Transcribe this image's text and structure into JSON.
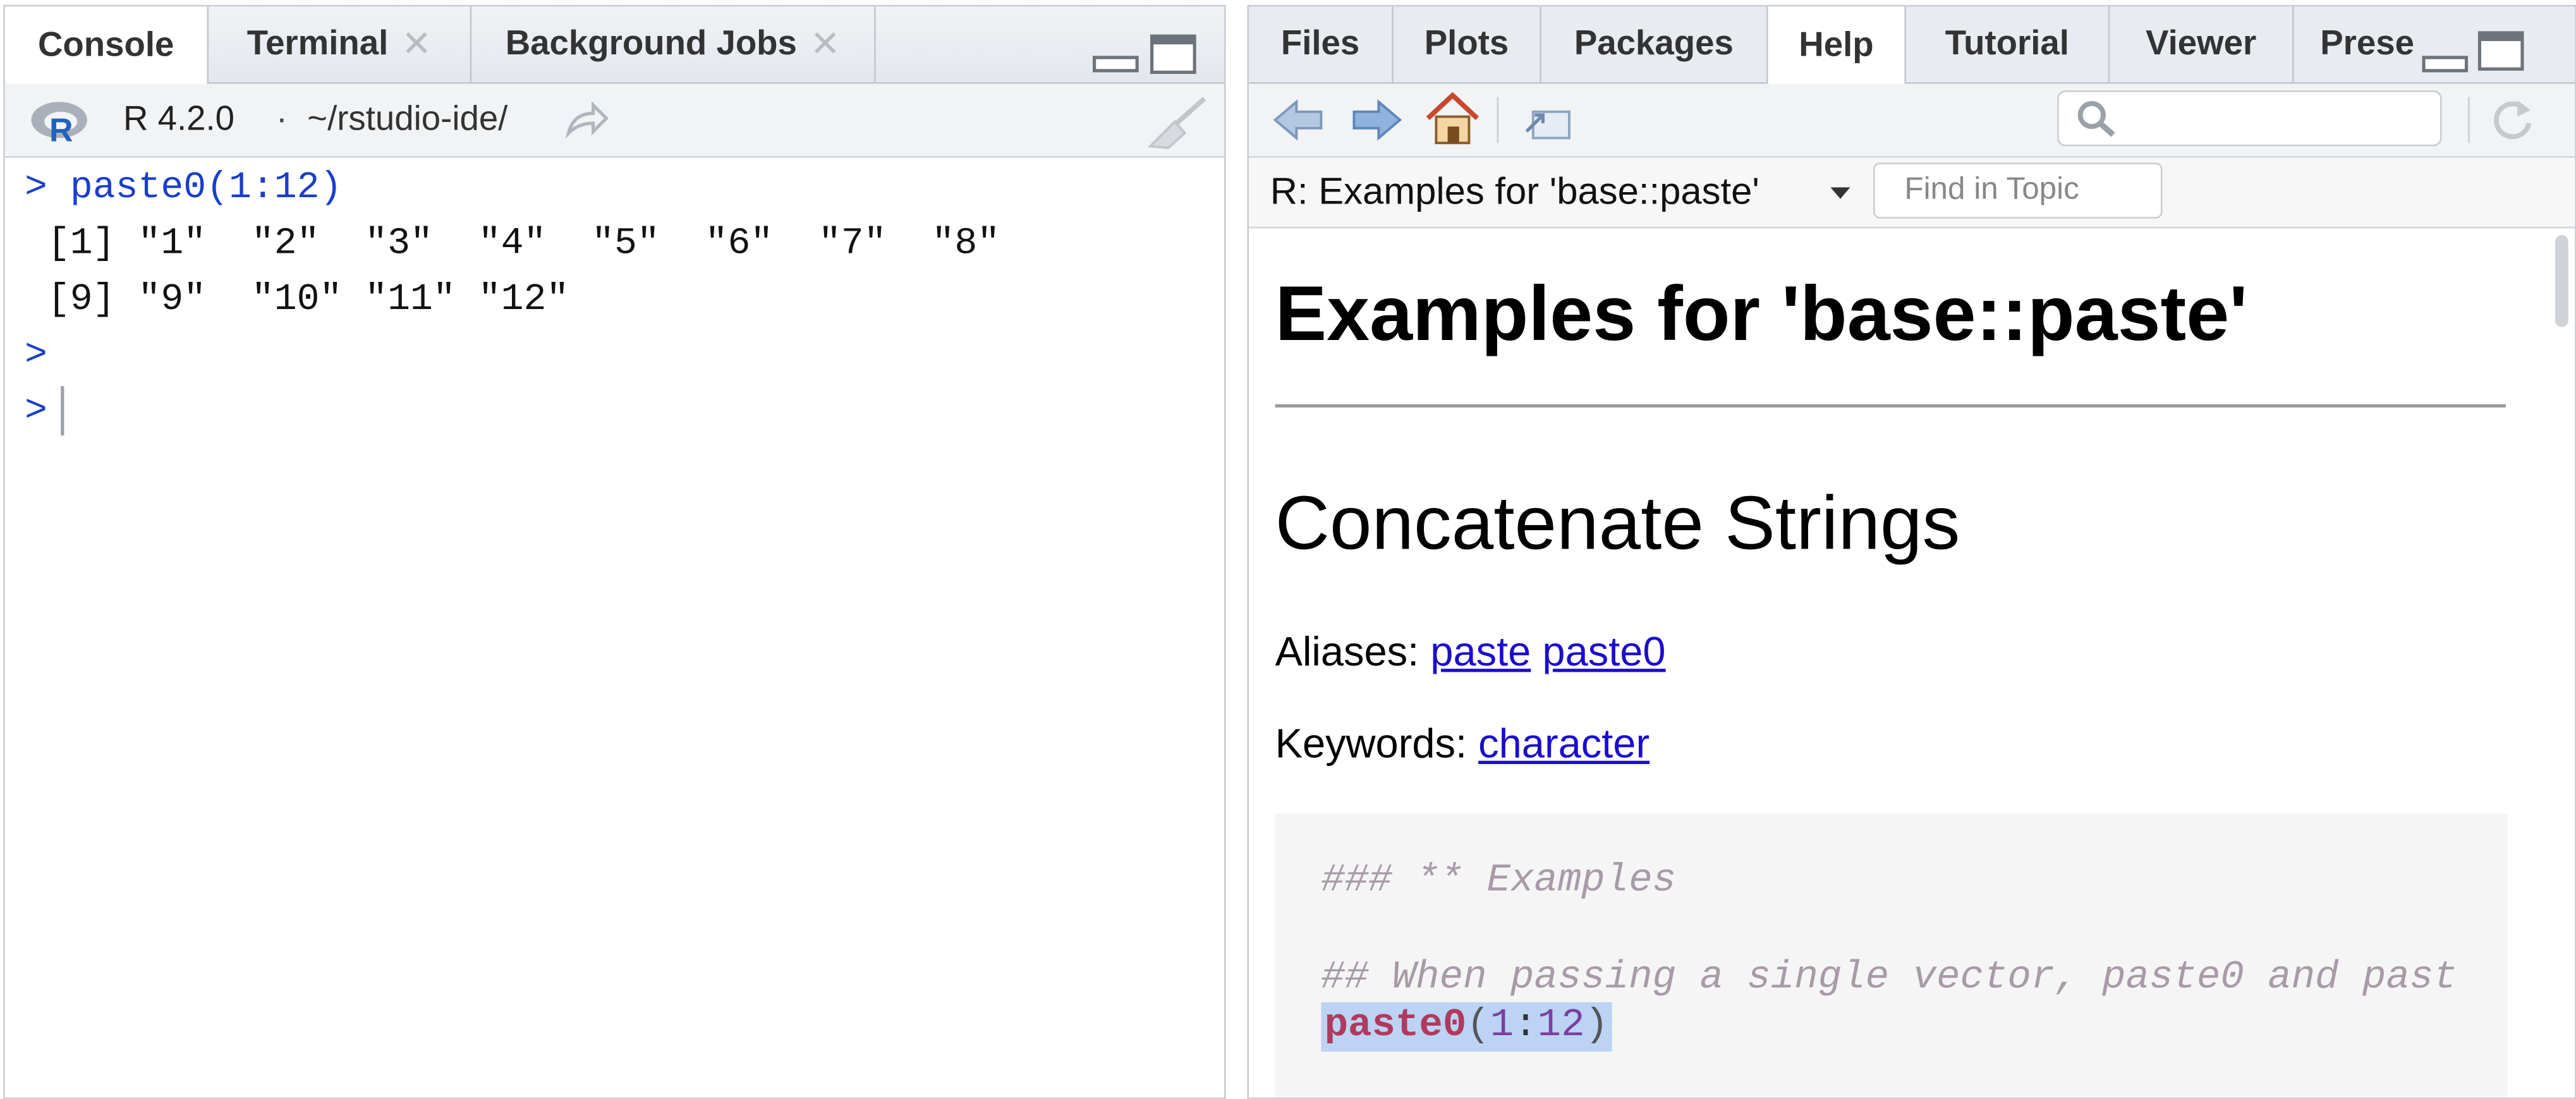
{
  "console_pane": {
    "tabs": [
      {
        "label": "Console"
      },
      {
        "label": "Terminal"
      },
      {
        "label": "Background Jobs"
      }
    ],
    "toolbar": {
      "r_version": "R 4.2.0",
      "separator": "·",
      "working_dir": "~/rstudio-ide/"
    },
    "lines": [
      {
        "prompt": ">",
        "text": "paste0(1:12)"
      },
      {
        "text": " [1] \"1\"  \"2\"  \"3\"  \"4\"  \"5\"  \"6\"  \"7\"  \"8\""
      },
      {
        "text": " [9] \"9\"  \"10\" \"11\" \"12\""
      },
      {
        "prompt": ">"
      },
      {
        "prompt": ">"
      }
    ]
  },
  "help_pane": {
    "tabs": [
      {
        "label": "Files"
      },
      {
        "label": "Plots"
      },
      {
        "label": "Packages"
      },
      {
        "label": "Help"
      },
      {
        "label": "Tutorial"
      },
      {
        "label": "Viewer"
      },
      {
        "label": "Prese"
      }
    ],
    "topic_title": "R: Examples for 'base::paste'",
    "find_placeholder": "Find in Topic",
    "search_placeholder": "",
    "doc": {
      "h1": "Examples for 'base::paste'",
      "h2": "Concatenate Strings",
      "aliases_label": "Aliases:",
      "aliases": [
        "paste",
        "paste0"
      ],
      "keywords_label": "Keywords:",
      "keywords": [
        "character"
      ],
      "code": {
        "comment1": "### ** Examples",
        "comment2": "## When passing a single vector, paste0 and past",
        "fn": "paste0",
        "open": "(",
        "n1": "1",
        "colon": ":",
        "n2": "12",
        "close": ")"
      }
    }
  },
  "icons": [
    "r-logo-icon",
    "forward-arrow-icon",
    "broom-icon",
    "minimize-icon",
    "maximize-icon",
    "back-arrow-icon",
    "home-icon",
    "popout-icon",
    "search-icon",
    "refresh-icon",
    "dropdown-caret-icon",
    "close-icon"
  ],
  "colors": {
    "prompt_blue": "#1a3ecc",
    "link_blue": "#1a0dcc",
    "code_comment": "#a89aa8",
    "code_keyword": "#b03a5e",
    "code_number": "#7b3fa0",
    "selection": "#bcd3f4"
  }
}
